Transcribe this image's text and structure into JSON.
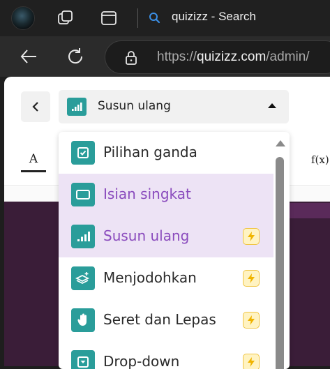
{
  "browser": {
    "tab_title": "quizizz - Search",
    "url_prefix": "https://",
    "url_domain": "quizizz.com",
    "url_path": "/admin/",
    "icons": [
      "profile-avatar",
      "workspaces-icon",
      "tab-actions-icon",
      "search-icon",
      "back-arrow-icon",
      "refresh-icon",
      "lock-icon"
    ]
  },
  "editor": {
    "question_type_selected": "Susun ulang",
    "toolbar": {
      "format_text_label": "A",
      "formula_label": "f(x)"
    }
  },
  "dropdown": {
    "items": [
      {
        "label": "Pilihan ganda",
        "icon": "checkbox-icon",
        "premium": false,
        "selected": false
      },
      {
        "label": "Isian singkat",
        "icon": "text-box-icon",
        "premium": false,
        "selected": true
      },
      {
        "label": "Susun ulang",
        "icon": "bars-icon",
        "premium": true,
        "selected": true
      },
      {
        "label": "Menjodohkan",
        "icon": "match-icon",
        "premium": true,
        "selected": false
      },
      {
        "label": "Seret dan Lepas",
        "icon": "hand-icon",
        "premium": true,
        "selected": false
      },
      {
        "label": "Drop-down",
        "icon": "dropdown-icon",
        "premium": true,
        "selected": false
      }
    ]
  },
  "colors": {
    "accent_teal": "#2a9d9a",
    "selected_bg": "#ede3f5",
    "selected_text": "#8a4bbd",
    "premium_badge": "#f0c544"
  }
}
